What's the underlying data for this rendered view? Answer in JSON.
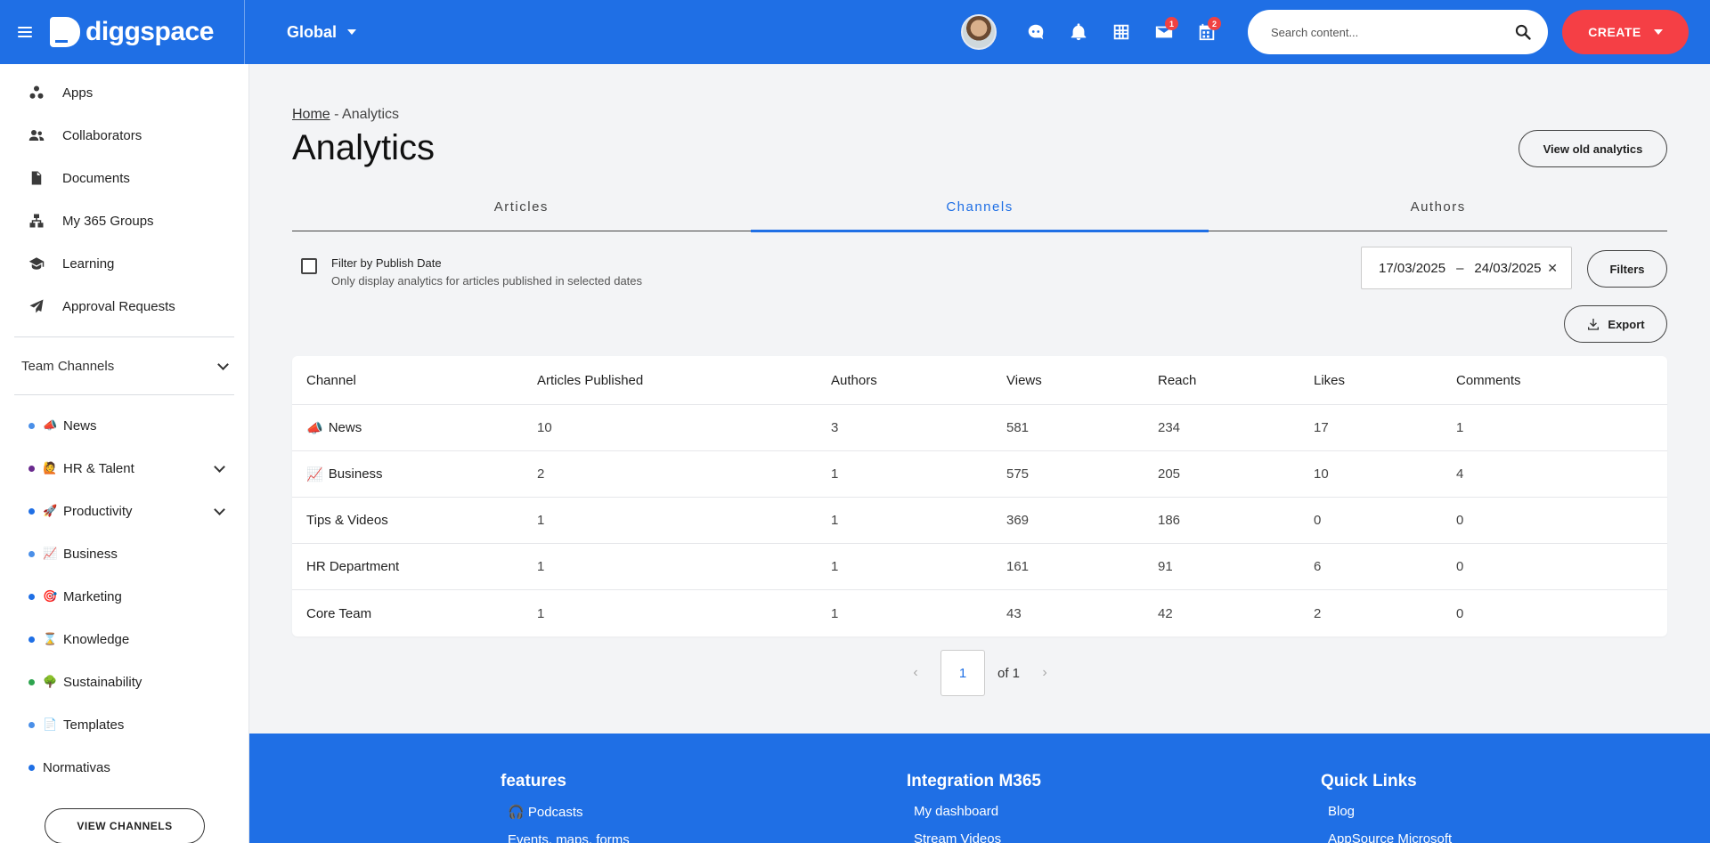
{
  "header": {
    "logo_text": "diggspace",
    "scope_label": "Global",
    "search_placeholder": "Search content...",
    "create_label": "CREATE",
    "mail_badge": "1",
    "calendar_badge": "2"
  },
  "sidebar": {
    "nav": [
      {
        "label": "Apps",
        "icon": "apps-icon"
      },
      {
        "label": "Collaborators",
        "icon": "users-icon"
      },
      {
        "label": "Documents",
        "icon": "document-icon"
      },
      {
        "label": "My 365 Groups",
        "icon": "groups-icon"
      },
      {
        "label": "Learning",
        "icon": "graduation-cap-icon"
      },
      {
        "label": "Approval Requests",
        "icon": "paper-plane-icon"
      }
    ],
    "section_title": "Team Channels",
    "channels": [
      {
        "label": "News",
        "emoji": "📣",
        "dot": "#4a8fe8"
      },
      {
        "label": "HR & Talent",
        "emoji": "🙋",
        "dot": "#6a2a8e"
      },
      {
        "label": "Productivity",
        "emoji": "🚀",
        "dot": "#1f6fe5"
      },
      {
        "label": "Business",
        "emoji": "📈",
        "dot": "#4a8fe8"
      },
      {
        "label": "Marketing",
        "emoji": "🎯",
        "dot": "#1f6fe5"
      },
      {
        "label": "Knowledge",
        "emoji": "⌛",
        "dot": "#1f6fe5"
      },
      {
        "label": "Sustainability",
        "emoji": "🌳",
        "dot": "#2ea44f"
      },
      {
        "label": "Templates",
        "emoji": "📄",
        "dot": "#4a8fe8"
      },
      {
        "label": "Normativas",
        "emoji": "",
        "dot": "#1f6fe5"
      }
    ],
    "view_channels_label": "VIEW CHANNELS"
  },
  "main": {
    "breadcrumb_home": "Home",
    "breadcrumb_sep": " - ",
    "breadcrumb_current": "Analytics",
    "title": "Analytics",
    "view_old_label": "View old analytics",
    "tabs": [
      "Articles",
      "Channels",
      "Authors"
    ],
    "active_tab": "Channels",
    "filter_label": "Filter by Publish Date",
    "filter_hint": "Only display analytics for articles published in selected dates",
    "date_from": "17/03/2025",
    "date_sep": "–",
    "date_to": "24/03/2025",
    "filters_label": "Filters",
    "export_label": "Export",
    "table": {
      "headers": [
        "Channel",
        "Articles Published",
        "Authors",
        "Views",
        "Reach",
        "Likes",
        "Comments"
      ],
      "rows": [
        {
          "emoji": "📣",
          "channel": "News",
          "articles": "10",
          "authors": "3",
          "views": "581",
          "reach": "234",
          "likes": "17",
          "comments": "1"
        },
        {
          "emoji": "📈",
          "channel": "Business",
          "articles": "2",
          "authors": "1",
          "views": "575",
          "reach": "205",
          "likes": "10",
          "comments": "4"
        },
        {
          "emoji": "",
          "channel": "Tips & Videos",
          "articles": "1",
          "authors": "1",
          "views": "369",
          "reach": "186",
          "likes": "0",
          "comments": "0"
        },
        {
          "emoji": "",
          "channel": "HR Department",
          "articles": "1",
          "authors": "1",
          "views": "161",
          "reach": "91",
          "likes": "6",
          "comments": "0"
        },
        {
          "emoji": "",
          "channel": "Core Team",
          "articles": "1",
          "authors": "1",
          "views": "43",
          "reach": "42",
          "likes": "2",
          "comments": "0"
        }
      ]
    },
    "pagination": {
      "current": "1",
      "of_label": "of 1"
    }
  },
  "footer": {
    "col1": {
      "title": "features",
      "links": [
        "🎧 Podcasts",
        "Events, maps, forms"
      ]
    },
    "col2": {
      "title": "Integration M365",
      "links": [
        "My dashboard",
        "Stream Videos"
      ]
    },
    "col3": {
      "title": "Quick Links",
      "links": [
        "Blog",
        "AppSource Microsoft"
      ]
    }
  },
  "colors": {
    "brand": "#1f6fe5",
    "create": "#f53f45",
    "badge": "#f04141"
  }
}
